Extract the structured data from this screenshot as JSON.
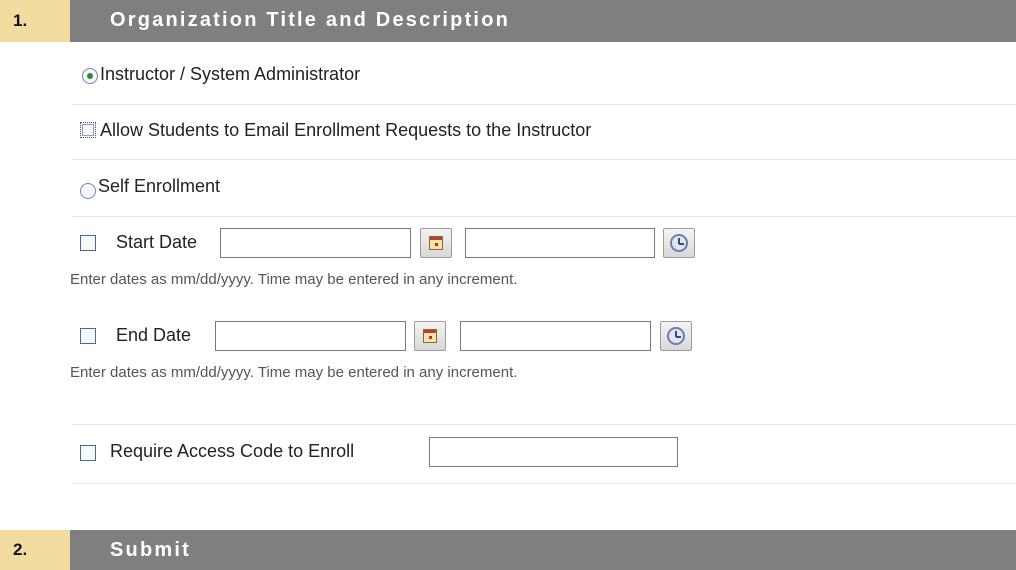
{
  "sections": [
    {
      "number": "1.",
      "title": "Organization Title and Description"
    },
    {
      "number": "2.",
      "title": "Submit"
    }
  ],
  "enrollment": {
    "instructor_option": {
      "label": "Instructor / System Administrator",
      "selected": true
    },
    "email_requests": {
      "label": "Allow Students to Email Enrollment Requests to the Instructor",
      "checked": false
    },
    "self_enrollment": {
      "label": "Self Enrollment",
      "selected": false
    },
    "start_date": {
      "label": "Start Date",
      "date_value": "",
      "time_value": "",
      "checked": false
    },
    "end_date": {
      "label": "End Date",
      "date_value": "",
      "time_value": "",
      "checked": false
    },
    "date_hint": "Enter dates as mm/dd/yyyy. Time may be entered in any increment.",
    "access_code": {
      "label": "Require Access Code to Enroll",
      "value": "",
      "checked": false
    }
  },
  "icons": {
    "calendar": "calendar-icon",
    "clock": "clock-icon"
  },
  "colors": {
    "header_bg": "#7f7f7f",
    "number_bg": "#f2dca0",
    "header_text": "#ffffff"
  }
}
